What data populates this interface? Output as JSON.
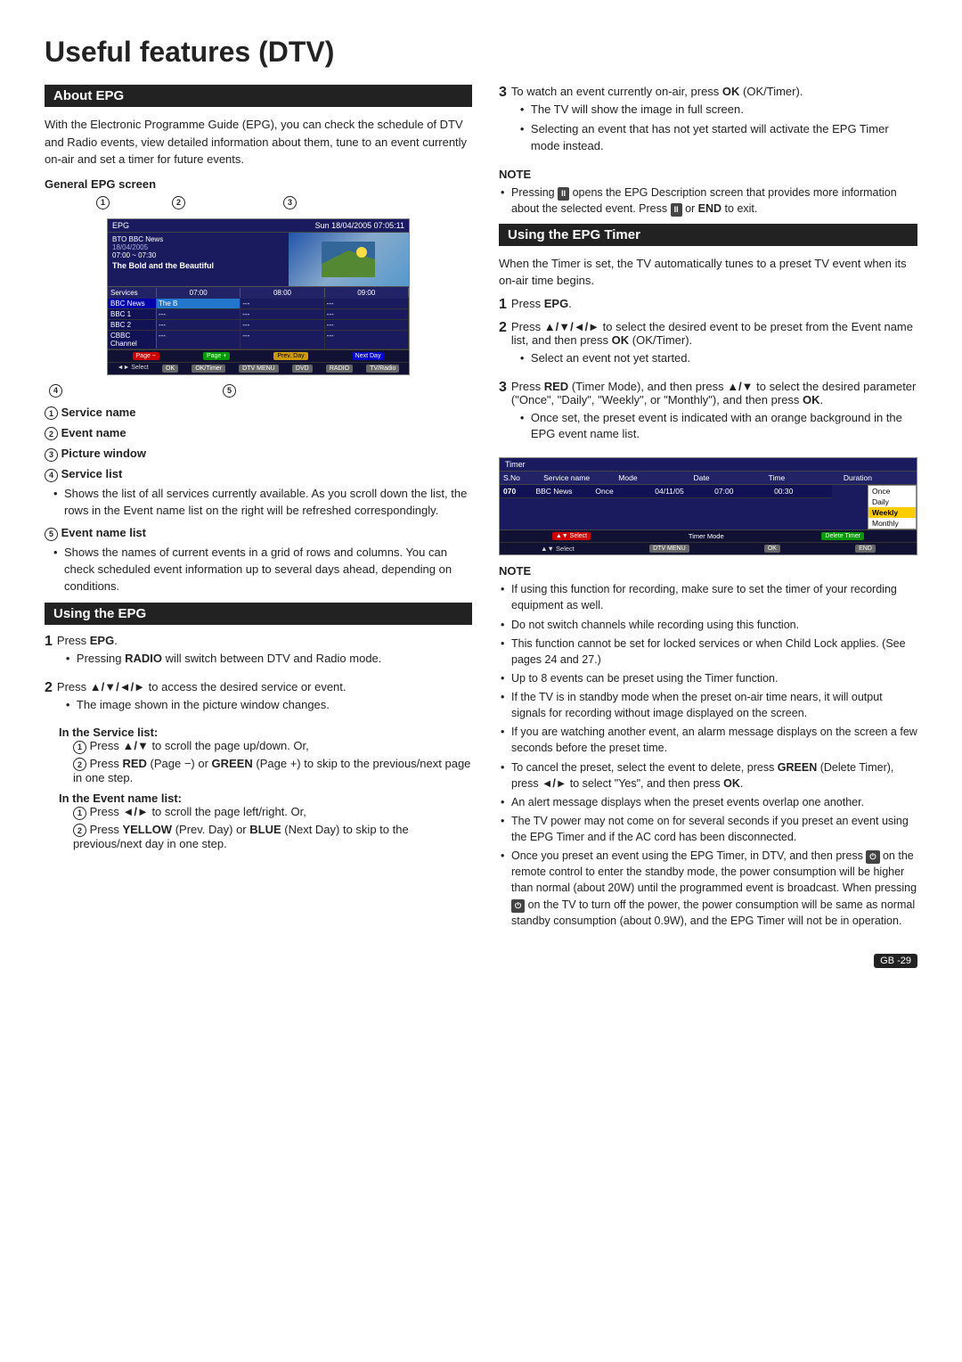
{
  "page": {
    "title": "Useful features (DTV)",
    "page_number": "GB -29"
  },
  "about_epg": {
    "section_title": "About EPG",
    "intro": "With the Electronic Programme Guide (EPG), you can check the schedule of DTV and Radio events, view detailed information about them, tune to an event currently on-air and set a timer for future events.",
    "general_screen_title": "General EPG screen",
    "epg_screen": {
      "top_bar_left": "EPG",
      "top_bar_right": "Sun 18/04/2005 07:05:11",
      "preview_channel": "BTO    BBC News",
      "preview_date": "18/04/2005",
      "preview_time": "07:00 ~ 07:30",
      "preview_title": "The Bold and the Beautiful",
      "time_slots": [
        "07:00",
        "08:00",
        "09:00"
      ],
      "services": [
        {
          "name": "BBC News",
          "events": [
            "The B",
            "---",
            "---"
          ]
        },
        {
          "name": "BBC 1",
          "events": [
            "---",
            "---",
            "---"
          ]
        },
        {
          "name": "BBC 2",
          "events": [
            "---",
            "---",
            "---"
          ]
        },
        {
          "name": "CBBC Channel",
          "events": [
            "---",
            "---",
            "---"
          ]
        }
      ],
      "bottom_buttons": [
        "Page -",
        "Page +",
        "Prev. Day",
        "Next Day",
        "Select",
        "OK/Timer",
        "DTV MENU",
        "DVD",
        "RADIO",
        "TV/Radio"
      ]
    },
    "callouts": [
      {
        "num": "1",
        "label": "Service name"
      },
      {
        "num": "2",
        "label": "Event name"
      },
      {
        "num": "3",
        "label": "Picture window"
      },
      {
        "num": "4",
        "label": "Service list",
        "detail": "Shows the list of all services currently available. As you scroll down the list, the rows in the Event name list on the right will be refreshed correspondingly."
      },
      {
        "num": "5",
        "label": "Event name list",
        "detail": "Shows the names of current events in a grid of rows and columns. You can check scheduled event information up to several days ahead, depending on conditions."
      }
    ]
  },
  "using_epg": {
    "section_title": "Using the EPG",
    "steps": [
      {
        "num": "1",
        "text": "Press EPG.",
        "bullets": [
          "Pressing RADIO will switch between DTV and Radio mode."
        ]
      },
      {
        "num": "2",
        "text": "Press ▲/▼/◄/► to access the desired service or event.",
        "bullets": [
          "The image shown in the picture window changes."
        ]
      }
    ],
    "service_list_title": "In the Service list:",
    "service_list_items": [
      "Press ▲/▼ to scroll the page up/down. Or,",
      "Press RED (Page −) or GREEN (Page +) to skip to the previous/next page in one step."
    ],
    "event_name_list_title": "In the Event name list:",
    "event_list_items": [
      "Press ◄/► to scroll the page left/right. Or,",
      "Press YELLOW (Prev. Day) or BLUE (Next Day) to skip to the previous/next day in one step."
    ]
  },
  "right_column": {
    "step3": {
      "num": "3",
      "text": "To watch an event currently on-air, press OK (OK/Timer).",
      "bullets": [
        "The TV will show the image in full screen.",
        "Selecting an event that has not yet started will activate the EPG Timer mode instead."
      ]
    },
    "note1": {
      "title": "NOTE",
      "bullets": [
        "Pressing [II] opens the EPG Description screen that provides more information about the selected event. Press [II] or END to exit."
      ]
    },
    "using_epg_timer": {
      "section_title": "Using the EPG Timer",
      "intro": "When the Timer is set, the TV automatically tunes to a preset TV event when its on-air time begins.",
      "steps": [
        {
          "num": "1",
          "text": "Press EPG."
        },
        {
          "num": "2",
          "text": "Press ▲/▼/◄/► to select the desired event to be preset from the Event name list, and then press OK (OK/Timer).",
          "bullets": [
            "Select an event not yet started."
          ]
        },
        {
          "num": "3",
          "text": "Press RED (Timer Mode), and then press ▲/▼ to select the desired parameter (\"Once\", \"Daily\", \"Weekly\", or \"Monthly\"), and then press OK.",
          "bullets": [
            "Once set, the preset event is indicated with an orange background in the EPG event name list."
          ]
        }
      ],
      "timer_box": {
        "header": "Timer",
        "col_headers": [
          "S.No",
          "Service name",
          "Mode",
          "Date",
          "Time",
          "Duration"
        ],
        "data_row": [
          "070",
          "BBC News",
          "Once",
          "04/11/05",
          "07:00",
          "00:30"
        ],
        "dropdown_items": [
          "Once",
          "Daily",
          "Weekly",
          "Monthly"
        ],
        "selected_item": "Weekly",
        "bottom_buttons": [
          "▲▼ Select",
          "DTV MENU",
          "OK",
          "END"
        ]
      },
      "note2": {
        "title": "NOTE",
        "bullets": [
          "If using this function for recording, make sure to set the timer of your recording equipment as well.",
          "Do not switch channels while recording using this function.",
          "This function cannot be set for locked services or when Child Lock applies. (See pages 24 and 27.)",
          "Up to 8 events can be preset using the Timer function.",
          "If the TV is in standby mode when the preset on-air time nears, it will output signals for recording without image displayed on the screen.",
          "If you are watching another event, an alarm message displays on the screen a few seconds before the preset time.",
          "To cancel the preset, select the event to delete, press GREEN (Delete Timer), press ◄/► to select \"Yes\", and then press OK.",
          "An alert message displays when the preset events overlap one another.",
          "The TV power may not come on for several seconds if you preset an event using the EPG Timer and if the AC cord has been disconnected.",
          "Once you preset an event using the EPG Timer, in DTV, and then press [power] on the remote control to enter the standby mode, the power consumption will be higher than normal (about 20W) until the programmed event is broadcast. When pressing [power] on the TV to turn off the power, the power consumption will be same as normal standby consumption (about 0.9W), and the EPG Timer will not be in operation."
        ]
      }
    }
  }
}
